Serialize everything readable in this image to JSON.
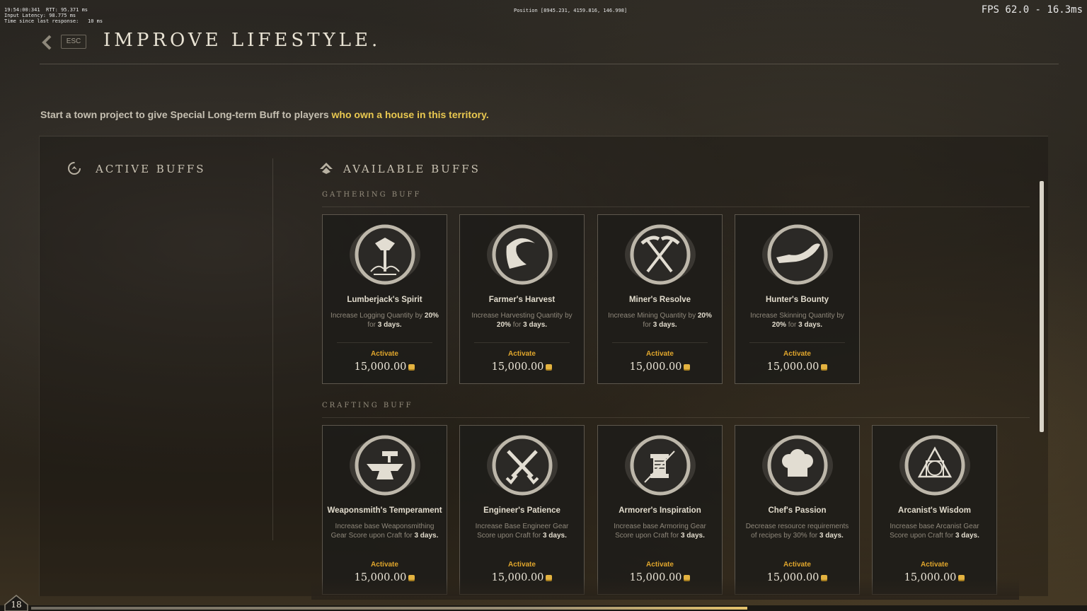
{
  "debug": {
    "top_left": "19:54:00:341  RTT: 95.371 ms\nInput Latency: 98.775 ms\nTime since last response:   10 ms",
    "position": "Position [8945.231, 4159.816, 146.998]",
    "fps": "FPS 62.0 - 16.3ms"
  },
  "header": {
    "esc_label": "ESC",
    "title": "IMPROVE LIFESTYLE."
  },
  "subtitle": {
    "text": "Start a town project to give Special Long-term Buff to players ",
    "highlight": "who own a house in this territory."
  },
  "active_buffs": {
    "heading": "ACTIVE BUFFS"
  },
  "available_buffs": {
    "heading": "AVAILABLE BUFFS",
    "groups": [
      {
        "label": "GATHERING BUFF",
        "cards": [
          {
            "name": "Lumberjack's Spirit",
            "icon": "axe-icon",
            "desc_pre": "Increase Logging Quantity by ",
            "pct": "20%",
            "desc_mid": " for ",
            "dur": "3 days.",
            "action": "Activate",
            "price": "15,000.00"
          },
          {
            "name": "Farmer's Harvest",
            "icon": "sickle-icon",
            "desc_pre": "Increase Harvesting Quantity by ",
            "pct": "20%",
            "desc_mid": " for ",
            "dur": "3 days.",
            "action": "Activate",
            "price": "15,000.00"
          },
          {
            "name": "Miner's Resolve",
            "icon": "pickaxes-icon",
            "desc_pre": "Increase Mining Quantity by ",
            "pct": "20%",
            "desc_mid": " for ",
            "dur": "3 days.",
            "action": "Activate",
            "price": "15,000.00"
          },
          {
            "name": "Hunter's Bounty",
            "icon": "skinning-knife-icon",
            "desc_pre": "Increase Skinning Quantity by ",
            "pct": "20%",
            "desc_mid": " for ",
            "dur": "3 days.",
            "action": "Activate",
            "price": "15,000.00"
          }
        ]
      },
      {
        "label": "CRAFTING BUFF",
        "cards": [
          {
            "name": "Weaponsmith's Temperament",
            "icon": "anvil-icon",
            "desc_pre": "Increase base Weaponsmithing Gear Score upon Craft for ",
            "pct": "",
            "desc_mid": "",
            "dur": "3 days.",
            "action": "Activate",
            "price": "15,000.00"
          },
          {
            "name": "Engineer's Patience",
            "icon": "crossed-pistols-icon",
            "desc_pre": "Increase Base Engineer Gear Score upon Craft for ",
            "pct": "",
            "desc_mid": "",
            "dur": "3 days.",
            "action": "Activate",
            "price": "15,000.00"
          },
          {
            "name": "Armorer's Inspiration",
            "icon": "spool-needle-icon",
            "desc_pre": "Increase base Armoring Gear Score upon Craft for ",
            "pct": "",
            "desc_mid": "",
            "dur": "3 days.",
            "action": "Activate",
            "price": "15,000.00"
          },
          {
            "name": "Chef's Passion",
            "icon": "chef-hat-icon",
            "desc_pre": "Decrease resource requirements of recipes by 30% for ",
            "pct": "",
            "desc_mid": "",
            "dur": "3 days.",
            "action": "Activate",
            "price": "15,000.00"
          },
          {
            "name": "Arcanist's Wisdom",
            "icon": "alchemy-circle-icon",
            "desc_pre": "Increase base Arcanist Gear Score upon Craft for ",
            "pct": "",
            "desc_mid": "",
            "dur": "3 days.",
            "action": "Activate",
            "price": "15,000.00"
          }
        ]
      }
    ]
  },
  "player": {
    "level": "18"
  },
  "colors": {
    "accent": "#e0a62c",
    "highlight": "#e9c850",
    "coin": "#e4b340"
  }
}
